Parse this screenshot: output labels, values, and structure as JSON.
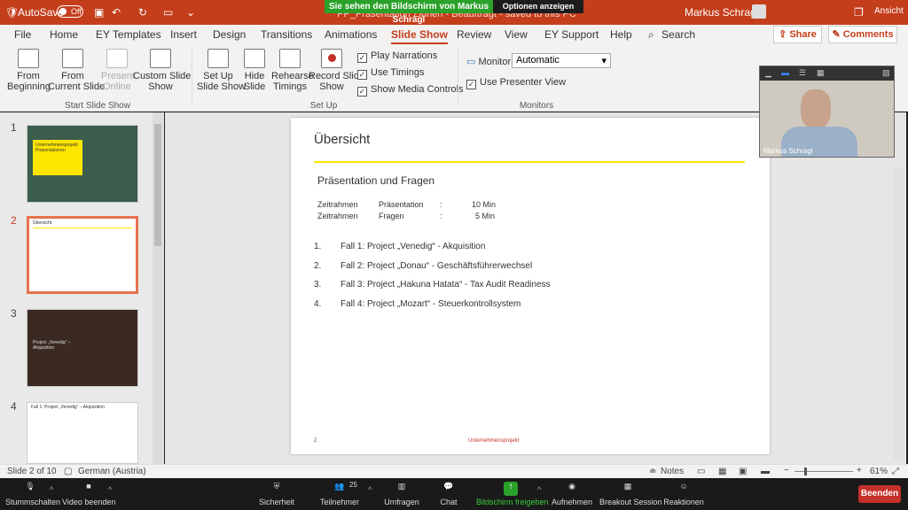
{
  "titlebar": {
    "autosave": "AutoSave",
    "autosave_state": "Off",
    "doc_title": "PP_Präsentation Zinnen - Beauftragt - saved to this PC",
    "user": "Markus Schragl",
    "view_btn": "Ansicht"
  },
  "zoom_share": {
    "banner": "Sie sehen den Bildschirm von Markus Schragl",
    "options": "Optionen anzeigen"
  },
  "tabs": [
    "File",
    "Home",
    "EY Templates",
    "Insert",
    "Design",
    "Transitions",
    "Animations",
    "Slide Show",
    "Review",
    "View",
    "EY Support",
    "Help"
  ],
  "active_tab": "Slide Show",
  "search": "Search",
  "share": "Share",
  "comments": "Comments",
  "ribbon": {
    "from_beginning": [
      "From",
      "Beginning"
    ],
    "from_current": [
      "From",
      "Current Slide"
    ],
    "present_online": [
      "Present",
      "Online"
    ],
    "custom_show": [
      "Custom Slide",
      "Show"
    ],
    "setup_show": [
      "Set Up",
      "Slide Show"
    ],
    "hide_slide": [
      "Hide",
      "Slide"
    ],
    "rehearse": [
      "Rehearse",
      "Timings"
    ],
    "record": [
      "Record Slide",
      "Show"
    ],
    "play_narrations": "Play Narrations",
    "use_timings": "Use Timings",
    "show_media": "Show Media Controls",
    "monitor_label": "Monitor:",
    "monitor_value": "Automatic",
    "presenter_view": "Use Presenter View",
    "group_start": "Start Slide Show",
    "group_setup": "Set Up",
    "group_monitors": "Monitors"
  },
  "thumbnails": [
    {
      "num": "1",
      "text": "Unternehmensprojekt Präsentationen"
    },
    {
      "num": "2",
      "text": "Übersicht"
    },
    {
      "num": "3",
      "text": "Project „Venedig“ – Akquisition"
    },
    {
      "num": "4",
      "text": "Fall 1: Project „Venedig“ – Akquisition"
    }
  ],
  "slide": {
    "title": "Übersicht",
    "subtitle": "Präsentation und Fragen",
    "rows": [
      {
        "a": "Zeitrahmen",
        "b": "Präsentation",
        "c": ":",
        "d": "10 Min"
      },
      {
        "a": "Zeitrahmen",
        "b": "Fragen",
        "c": ":",
        "d": "5 Min"
      }
    ],
    "items": [
      {
        "n": "1.",
        "t": "Fall 1: Project „Venedig“ - Akquisition"
      },
      {
        "n": "2.",
        "t": "Fall 2: Project „Donau“ - Geschäftsführerwechsel"
      },
      {
        "n": "3.",
        "t": "Fall 3: Project „Hakuna Hatata“ - Tax Audit Readiness"
      },
      {
        "n": "4.",
        "t": "Fall 4: Project „Mozart“ - Steuerkontrollsystem"
      }
    ],
    "page": "2",
    "footer": "Unternehmensprojekt"
  },
  "video_name": "Markus Schragl",
  "status": {
    "slide": "Slide 2 of 10",
    "lang": "German (Austria)",
    "notes": "Notes",
    "zoom": "61%"
  },
  "zoombar": {
    "mute": "Stummschalten",
    "video": "Video beenden",
    "security": "Sicherheit",
    "participants": "Teilnehmer",
    "participants_count": "25",
    "polls": "Umfragen",
    "chat": "Chat",
    "share": "Bildschirm freigeben",
    "record": "Aufnehmen",
    "breakout": "Breakout Session",
    "reactions": "Reaktionen",
    "end": "Beenden"
  },
  "colors": {
    "accent": "#c43e1c",
    "share_green": "#2aa22a",
    "slide_rule": "#ffe600"
  }
}
